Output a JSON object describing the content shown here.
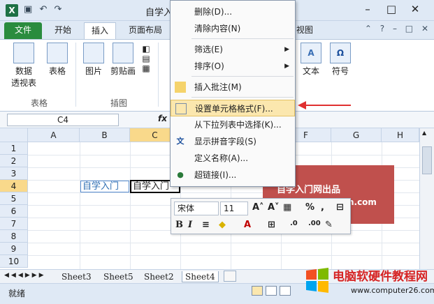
{
  "window": {
    "app_icon": "X",
    "title": "自学入",
    "qat_icons": [
      "save-icon",
      "undo-icon",
      "redo-icon"
    ],
    "controls": [
      "–",
      "□",
      "✕"
    ]
  },
  "tabs": [
    "文件",
    "开始",
    "插入",
    "页面布局",
    "视图"
  ],
  "ribbon": {
    "pivot_label": "数据\n透视表",
    "table_label": "表格",
    "picture_label": "图片",
    "clipart_label": "剪贴画",
    "text_label": "文本",
    "symbol_label": "符号",
    "symbol_glyph": "Ω",
    "groups": [
      "表格",
      "插图"
    ]
  },
  "formula_bar": {
    "name_box": "C4",
    "fx": "fx"
  },
  "grid": {
    "columns": [
      "A",
      "B",
      "C",
      "D",
      "E",
      "F",
      "G",
      "H"
    ],
    "rows": [
      "1",
      "2",
      "3",
      "4",
      "5",
      "6",
      "7",
      "8",
      "9",
      "10"
    ],
    "b4": "自学入门",
    "c4": "自学入门"
  },
  "banner": {
    "line1": "自学入门网出品",
    "line2": "m.com"
  },
  "context_menu": {
    "items": [
      "删除(D)...",
      "清除内容(N)",
      "筛选(E)",
      "排序(O)",
      "插入批注(M)",
      "设置单元格格式(F)...",
      "从下拉列表中选择(K)...",
      "显示拼音字段(S)",
      "定义名称(A)...",
      "超链接(I)..."
    ]
  },
  "mini_toolbar": {
    "font": "宋体",
    "size": "11",
    "percent": "%",
    "comma": ","
  },
  "sheet_tabs": [
    "Sheet3",
    "Sheet5",
    "Sheet2",
    "Sheet4"
  ],
  "status": {
    "ready": "就绪"
  },
  "watermark": {
    "title": "电脑软硬件教程网",
    "url": "www.computer26.com"
  },
  "colors": {
    "accent_file_tab": "#2a8c3e",
    "banner": "#c0504d",
    "highlight": "#fbe7ae",
    "arrow": "#e03030",
    "watermark_title": "#d62424"
  }
}
